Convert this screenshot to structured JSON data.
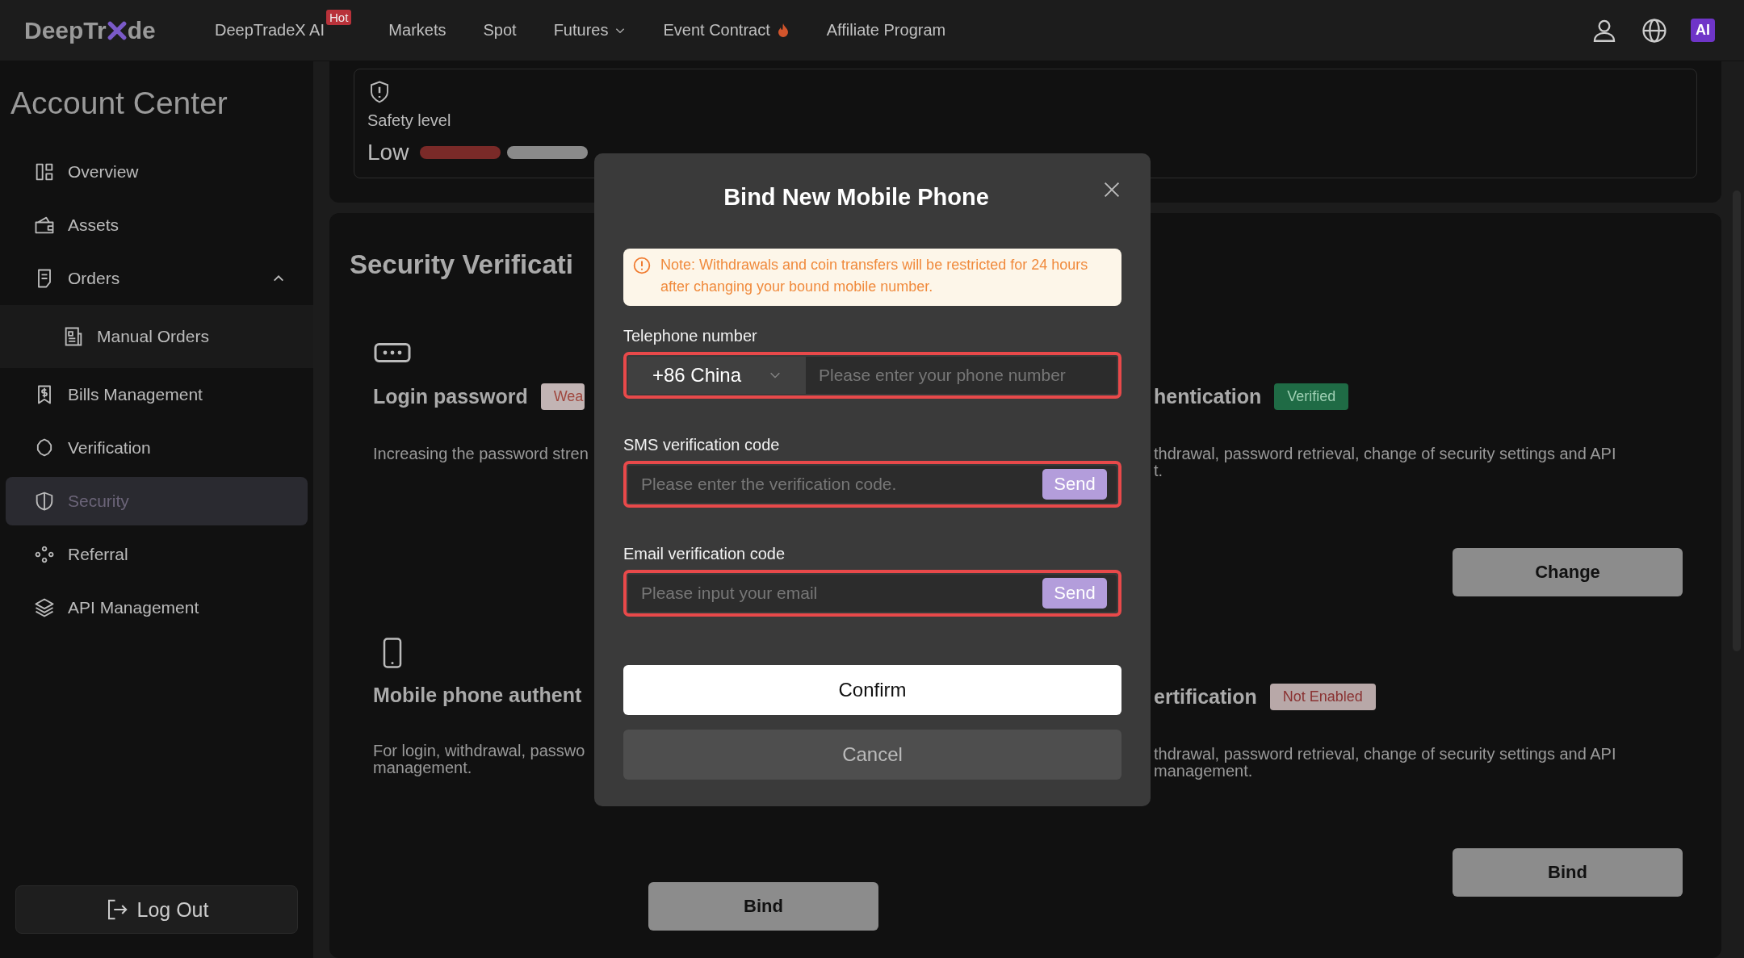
{
  "header": {
    "logo": {
      "before": "DeepTr",
      "after": "de"
    },
    "nav": [
      {
        "label": "DeepTradeX AI",
        "badge": "Hot",
        "kind": "plain"
      },
      {
        "label": "Markets",
        "kind": "plain"
      },
      {
        "label": "Spot",
        "kind": "plain"
      },
      {
        "label": "Futures",
        "kind": "dropdown"
      },
      {
        "label": "Event Contract",
        "kind": "flame"
      },
      {
        "label": "Affiliate Program",
        "kind": "plain"
      }
    ],
    "ai_badge": "AI"
  },
  "sidebar": {
    "title": "Account Center",
    "items": [
      {
        "label": "Overview",
        "selected": false
      },
      {
        "label": "Assets",
        "selected": false
      },
      {
        "label": "Orders",
        "selected": false,
        "expanded": true,
        "children": [
          {
            "label": "Manual Orders",
            "selected": false
          }
        ]
      },
      {
        "label": "Bills Management",
        "selected": false
      },
      {
        "label": "Verification",
        "selected": false
      },
      {
        "label": "Security",
        "selected": true
      },
      {
        "label": "Referral",
        "selected": false
      },
      {
        "label": "API Management",
        "selected": false
      }
    ],
    "logout": "Log Out"
  },
  "safety": {
    "label": "Safety level",
    "level_text": "Low",
    "segments": [
      {
        "filled": true
      },
      {
        "filled": false
      }
    ]
  },
  "security": {
    "title": "Security Verificati",
    "cards": [
      {
        "kind": "password",
        "title": "Login password",
        "badge": {
          "text": "Wea",
          "kind": "weak"
        },
        "description": [
          "Increasing the password stren"
        ]
      },
      {
        "kind": "authenticator",
        "title": "hentication",
        "badge": {
          "text": "Verified",
          "kind": "verified"
        },
        "description": [
          "thdrawal, password retrieval, change of security settings and API",
          "t."
        ],
        "button": "Change"
      },
      {
        "kind": "phone",
        "title": "Mobile phone authent",
        "description": [
          "For login, withdrawal, passwo",
          "management."
        ],
        "button": "Bind"
      },
      {
        "kind": "certification",
        "title": "ertification",
        "badge": {
          "text": "Not Enabled",
          "kind": "off"
        },
        "description": [
          "thdrawal, password retrieval, change of security settings and API",
          "management."
        ],
        "button": "Bind"
      }
    ]
  },
  "modal": {
    "title": "Bind New Mobile Phone",
    "note": "Note: Withdrawals and coin transfers will be restricted for 24 hours after changing your bound mobile number.",
    "fields": [
      {
        "kind": "phone",
        "label": "Telephone number",
        "country": "+86 China",
        "placeholder": "Please enter your phone number",
        "highlighted": true
      },
      {
        "kind": "code",
        "label": "SMS verification code",
        "placeholder": "Please enter the verification code.",
        "button": "Send",
        "highlighted": true
      },
      {
        "kind": "code",
        "label": "Email verification code",
        "placeholder": "Please input your email",
        "button": "Send",
        "highlighted": true
      }
    ],
    "confirm": "Confirm",
    "cancel": "Cancel"
  }
}
